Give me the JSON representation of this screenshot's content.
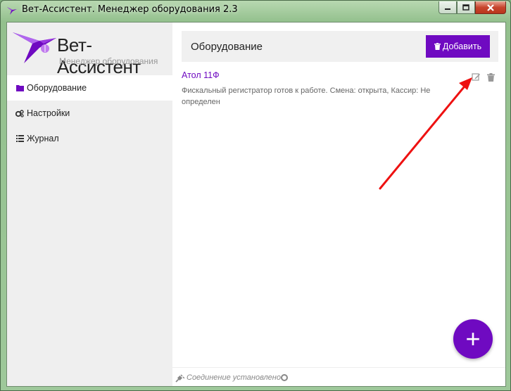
{
  "window": {
    "title": "Вет-Ассистент. Менеджер оборудования 2.3"
  },
  "logo": {
    "name": "Вет-Ассистент",
    "subtitle": "Менеджер оборудования"
  },
  "sidebar": {
    "items": [
      {
        "label": "Оборудование",
        "icon": "folder-icon",
        "active": true
      },
      {
        "label": "Настройки",
        "icon": "gears-icon",
        "active": false
      },
      {
        "label": "Журнал",
        "icon": "list-icon",
        "active": false
      }
    ]
  },
  "main": {
    "title": "Оборудование",
    "add_label": "Добавить"
  },
  "device": {
    "name": "Атол 11Ф",
    "description": "Фискальный регистратор готов к работе. Смена: открыта, Кассир: Не определен"
  },
  "status": {
    "text": "Соединение установлено"
  },
  "fab": {
    "label": "+"
  },
  "colors": {
    "accent": "#6f0ac1",
    "annotation_arrow": "#ee1111"
  }
}
